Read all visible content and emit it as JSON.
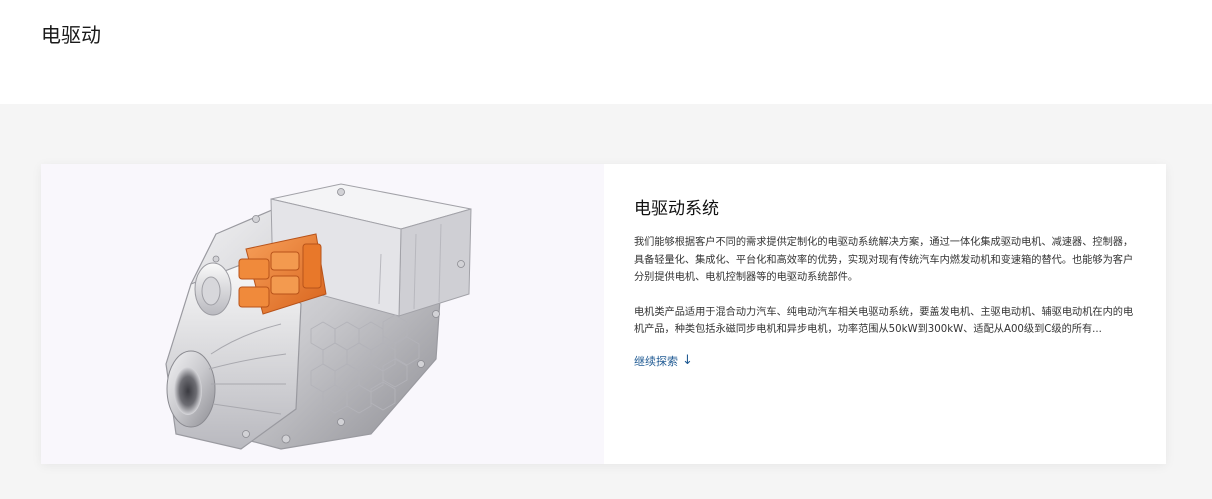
{
  "header": {
    "title": "电驱动"
  },
  "card": {
    "image_alt": "electric drive unit",
    "title": "电驱动系统",
    "paragraphs": [
      "我们能够根据客户不同的需求提供定制化的电驱动系统解决方案，通过一体化集成驱动电机、减速器、控制器，具备轻量化、集成化、平台化和高效率的优势，实现对现有传统汽车内燃发动机和变速箱的替代。也能够为客户分别提供电机、电机控制器等的电驱动系统部件。",
      "电机类产品适用于混合动力汽车、纯电动汽车相关电驱动系统，要盖发电机、主驱电动机、辅驱电动机在内的电机产品，种类包括永磁同步电机和异步电机，功率范围从50kW到300kW、适配从A00级到C级的所有..."
    ],
    "link_label": "继续探索",
    "link_icon": "arrow-down-icon",
    "link_arrow": "↓"
  },
  "colors": {
    "link": "#1f5a93",
    "accent_orange": "#e8782a",
    "background": "#f5f5f5"
  }
}
